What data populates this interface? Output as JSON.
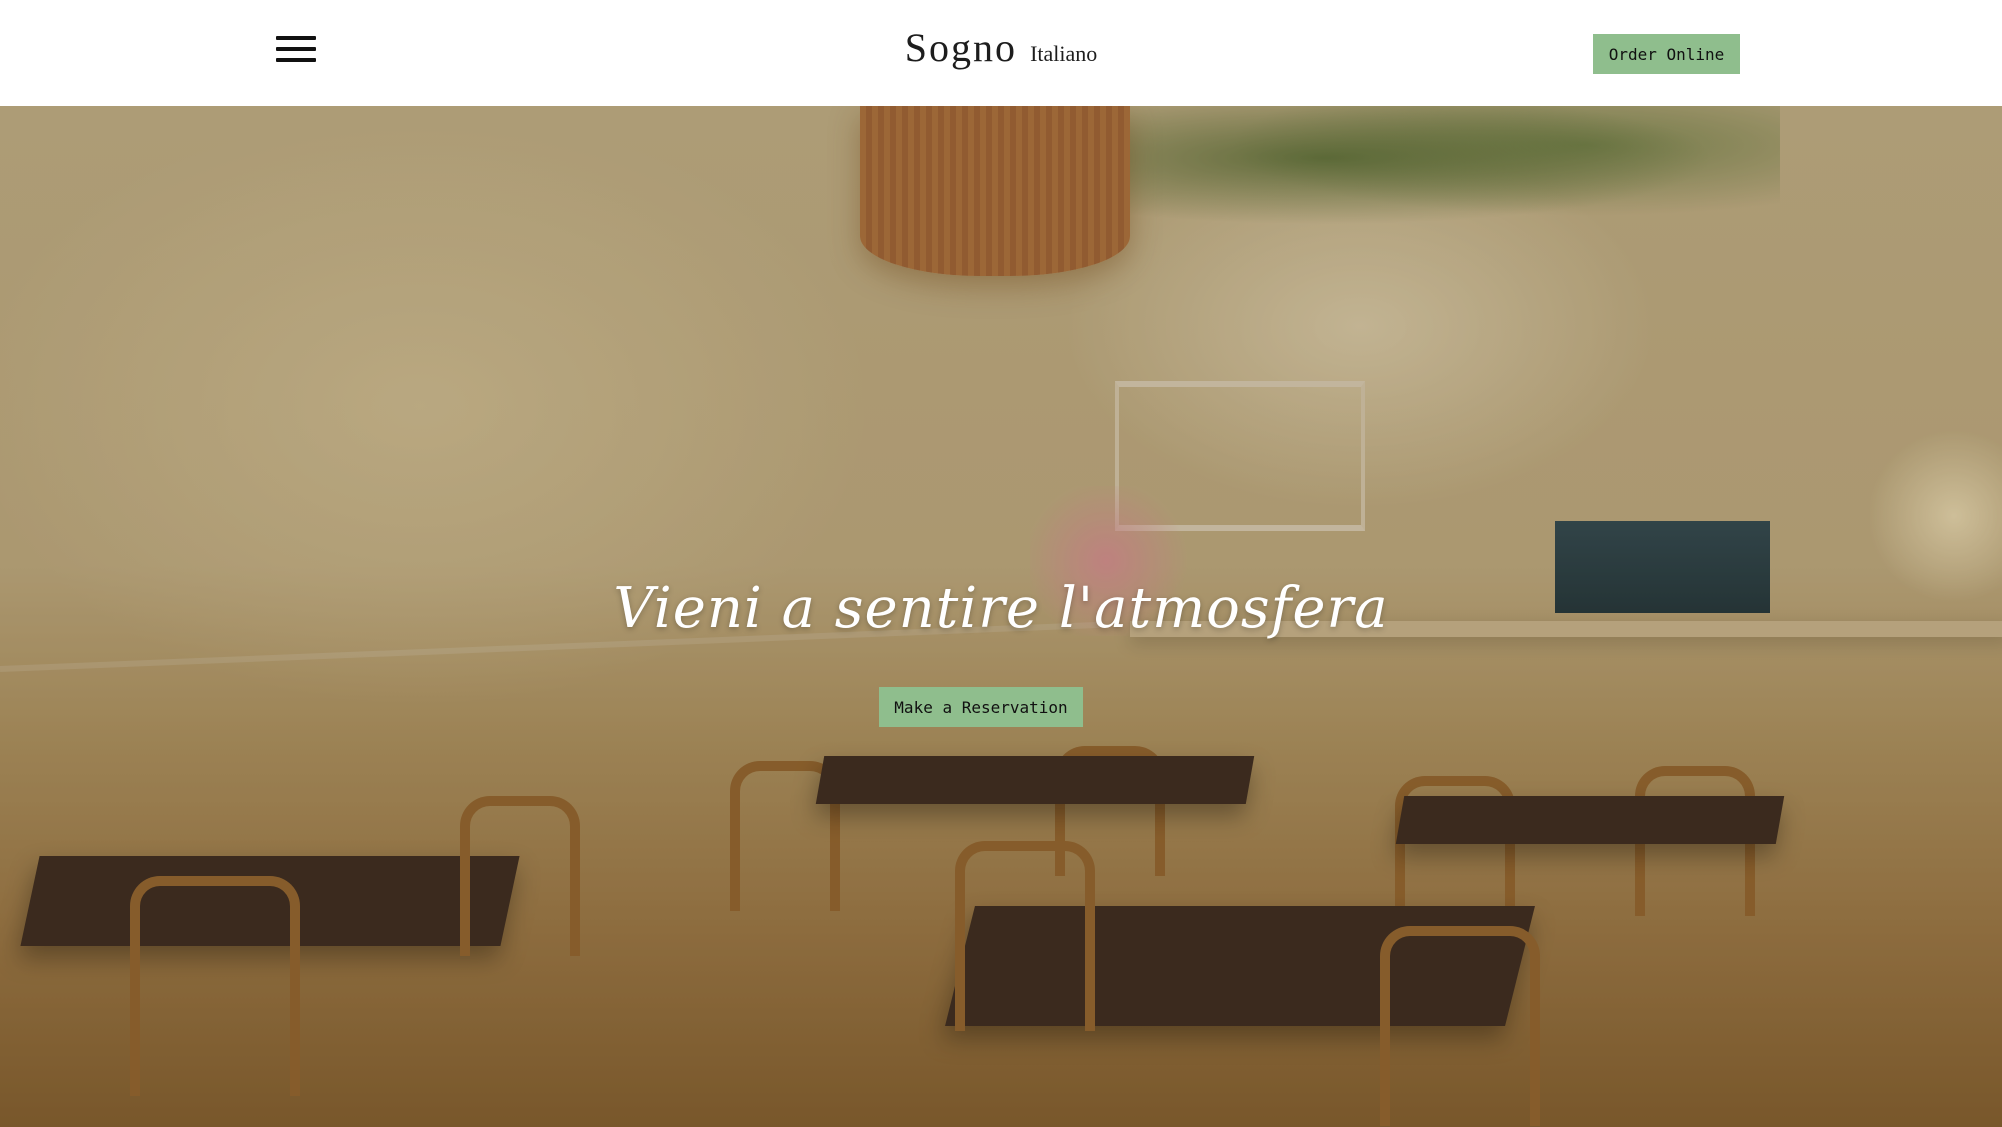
{
  "header": {
    "brand_name": "Sogno",
    "brand_sub": "Italiano",
    "order_label": "Order Online"
  },
  "hero": {
    "title": "Vieni a sentire l'atmosfera",
    "reservation_label": "Make a Reservation"
  },
  "colors": {
    "accent_button": "#8fbe8d",
    "header_bg": "#ffffff",
    "hero_text": "#ffffff"
  },
  "icons": {
    "menu": "hamburger-menu-icon"
  }
}
